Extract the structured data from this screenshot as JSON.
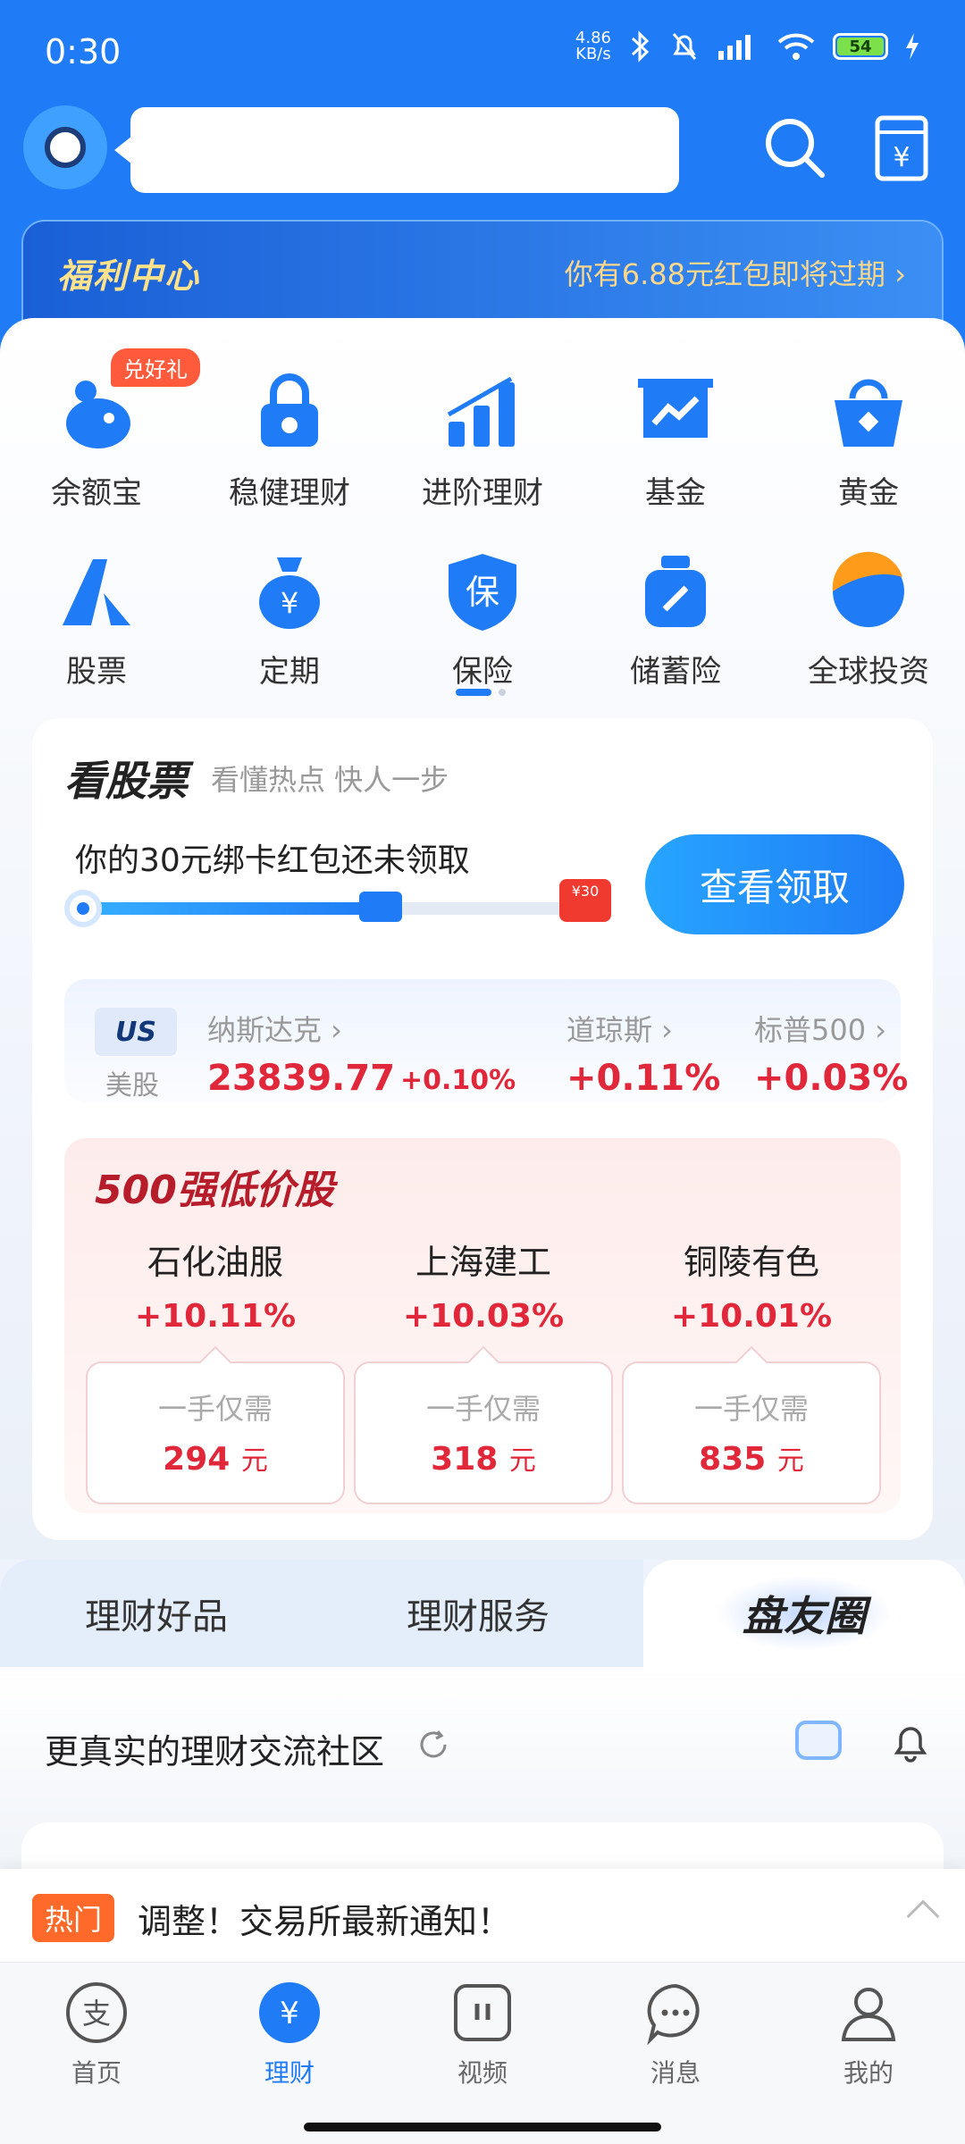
{
  "status_bar": {
    "time": "0:30",
    "net_speed_value": "4.86",
    "net_speed_unit": "KB/s",
    "battery": "54"
  },
  "welfare": {
    "title": "福利中心",
    "tip": "你有6.88元红包即将过期 ›"
  },
  "grid": {
    "badge": "兑好礼",
    "items": [
      {
        "label": "余额宝",
        "icon": "yuebao-icon"
      },
      {
        "label": "稳健理财",
        "icon": "lock-icon"
      },
      {
        "label": "进阶理财",
        "icon": "bar-chart-icon"
      },
      {
        "label": "基金",
        "icon": "trend-chart-icon"
      },
      {
        "label": "黄金",
        "icon": "gold-bag-icon"
      },
      {
        "label": "股票",
        "icon": "stock-icon"
      },
      {
        "label": "定期",
        "icon": "money-bag-icon"
      },
      {
        "label": "保险",
        "icon": "shield-icon"
      },
      {
        "label": "储蓄险",
        "icon": "savings-jar-icon"
      },
      {
        "label": "全球投资",
        "icon": "globe-icon"
      }
    ]
  },
  "stock_card": {
    "title": "看股票",
    "subtitle": "看懂热点 快人一步",
    "tip": "你的30元绑卡红包还未领取",
    "progress": 0.6,
    "envelope_label": "¥30",
    "button": "查看领取",
    "market_badge": "US",
    "market_label": "美股",
    "indices": [
      {
        "name": "纳斯达克 ›",
        "value": "23839.77",
        "change": "+0.10%"
      },
      {
        "name": "道琼斯 ›",
        "value": "+0.11%",
        "change": ""
      },
      {
        "name": "标普500 ›",
        "value": "+0.03%",
        "change": ""
      }
    ],
    "hot_title": "500强低价股",
    "hot_stocks": [
      {
        "name": "石化油服",
        "pct": "+10.11%",
        "min_label": "一手仅需",
        "min_value": "294",
        "unit": "元"
      },
      {
        "name": "上海建工",
        "pct": "+10.03%",
        "min_label": "一手仅需",
        "min_value": "318",
        "unit": "元"
      },
      {
        "name": "铜陵有色",
        "pct": "+10.01%",
        "min_label": "一手仅需",
        "min_value": "835",
        "unit": "元"
      }
    ]
  },
  "tabs": [
    "理财好品",
    "理财服务",
    "盘友圈"
  ],
  "community": {
    "title": "更真实的理财交流社区"
  },
  "notice": {
    "tag": "热门",
    "text": "调整！交易所最新通知！"
  },
  "bottom_nav": [
    {
      "label": "首页",
      "icon": "alipay-icon",
      "active": false
    },
    {
      "label": "理财",
      "icon": "yuan-icon",
      "active": true
    },
    {
      "label": "视频",
      "icon": "video-icon",
      "active": false
    },
    {
      "label": "消息",
      "icon": "message-icon",
      "active": false
    },
    {
      "label": "我的",
      "icon": "profile-icon",
      "active": false
    }
  ],
  "colors": {
    "brand_blue": "#1f7cf6",
    "rise_red": "#e0283a"
  }
}
